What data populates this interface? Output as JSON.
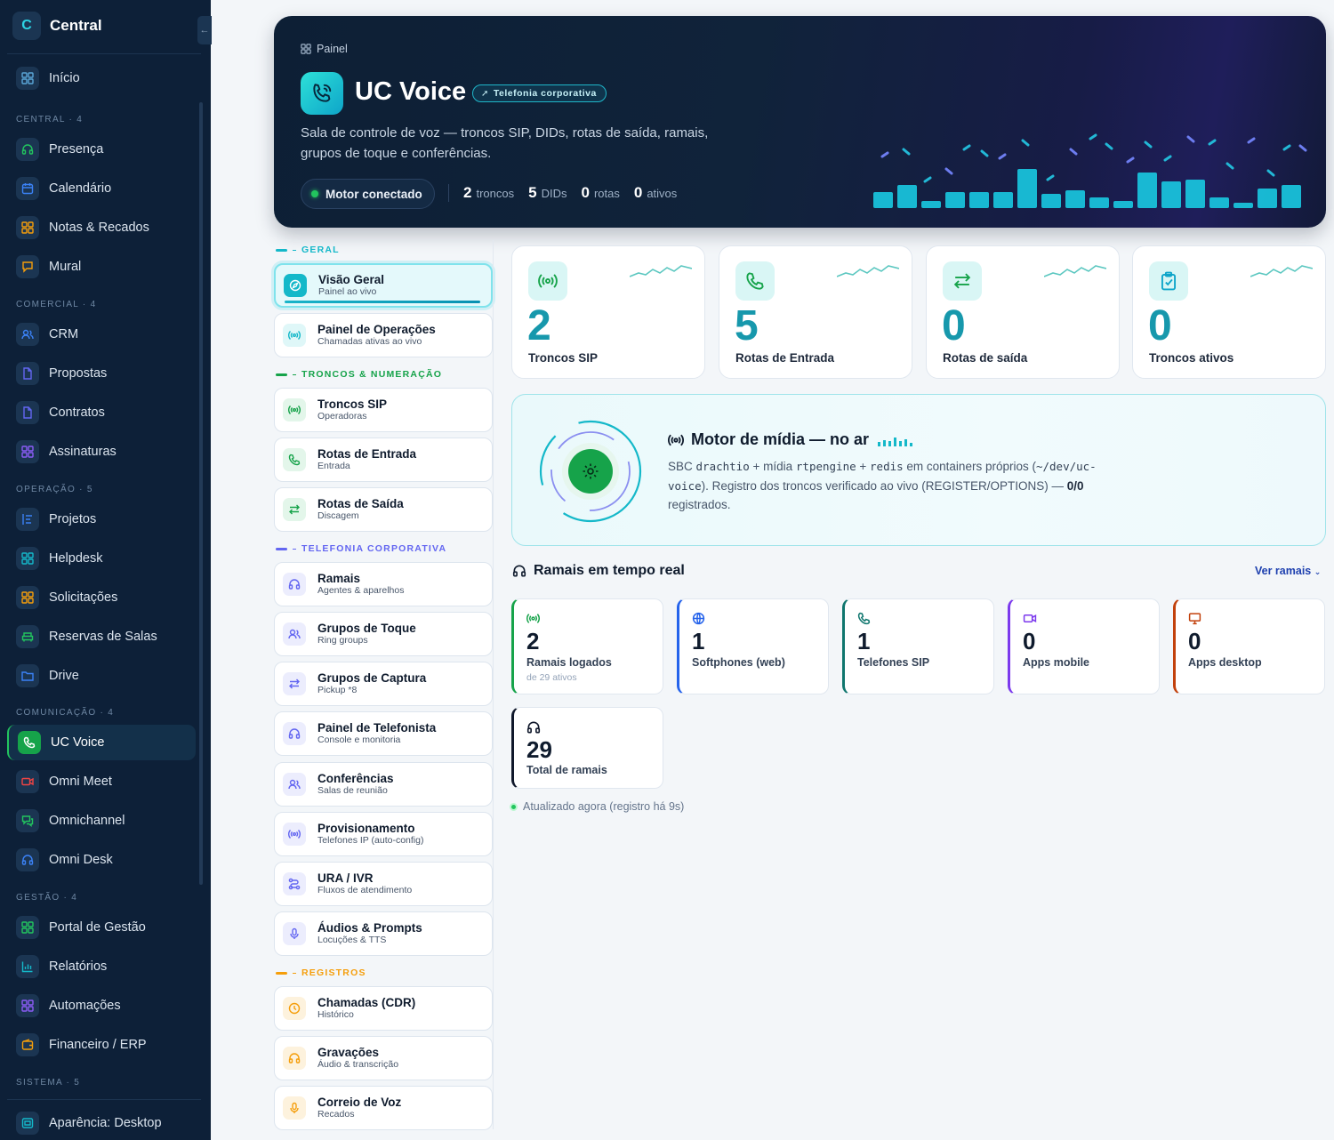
{
  "sidebar": {
    "brand": "Central",
    "items": [
      {
        "label": "Início",
        "icon": "grid-icon"
      },
      {
        "label": "Presença",
        "icon": "headset-icon"
      },
      {
        "label": "Calendário",
        "icon": "calendar-icon"
      },
      {
        "label": "Notas & Recados",
        "icon": "grid-icon"
      },
      {
        "label": "Mural",
        "icon": "message-icon"
      },
      {
        "label": "CRM",
        "icon": "users-icon"
      },
      {
        "label": "Propostas",
        "icon": "file-icon"
      },
      {
        "label": "Contratos",
        "icon": "file-icon"
      },
      {
        "label": "Assinaturas",
        "icon": "grid-icon"
      },
      {
        "label": "Projetos",
        "icon": "list-icon"
      },
      {
        "label": "Helpdesk",
        "icon": "grid-icon"
      },
      {
        "label": "Solicitações",
        "icon": "grid-icon"
      },
      {
        "label": "Reservas de Salas",
        "icon": "sofa-icon"
      },
      {
        "label": "Drive",
        "icon": "folder-icon"
      },
      {
        "label": "UC Voice",
        "icon": "phone-icon"
      },
      {
        "label": "Omni Meet",
        "icon": "video-icon"
      },
      {
        "label": "Omnichannel",
        "icon": "chat-icon"
      },
      {
        "label": "Omni Desk",
        "icon": "headset-icon"
      },
      {
        "label": "Portal de Gestão",
        "icon": "grid-icon"
      },
      {
        "label": "Relatórios",
        "icon": "chart-icon"
      },
      {
        "label": "Automações",
        "icon": "grid-icon"
      },
      {
        "label": "Financeiro / ERP",
        "icon": "wallet-icon"
      },
      {
        "label": "Aparência: Desktop",
        "icon": "monitor-icon"
      }
    ],
    "groups": [
      {
        "label": "CENTRAL · 4"
      },
      {
        "label": "COMERCIAL · 4"
      },
      {
        "label": "OPERAÇÃO · 5"
      },
      {
        "label": "COMUNICAÇÃO · 4"
      },
      {
        "label": "GESTÃO · 4"
      },
      {
        "label": "SISTEMA · 5"
      }
    ]
  },
  "hero": {
    "breadcrumb": "Painel",
    "title": "UC Voice",
    "tag": "Telefonia corporativa",
    "description": "Sala de controle de voz — troncos SIP, DIDs, rotas de saída, ramais, grupos de toque e conferências.",
    "status": "Motor conectado",
    "stats": [
      {
        "value": "2",
        "label": "troncos"
      },
      {
        "value": "5",
        "label": "DIDs"
      },
      {
        "value": "0",
        "label": "rotas"
      },
      {
        "value": "0",
        "label": "ativos"
      }
    ]
  },
  "subnav": {
    "groups": [
      {
        "label": "GERAL",
        "color": "#14b8c9"
      },
      {
        "label": "TRONCOS & NUMERAÇÃO",
        "color": "#16a34a"
      },
      {
        "label": "TELEFONIA CORPORATIVA",
        "color": "#6366f1"
      },
      {
        "label": "REGISTROS",
        "color": "#f59e0b"
      }
    ],
    "items": [
      {
        "title": "Visão Geral",
        "subtitle": "Painel ao vivo"
      },
      {
        "title": "Painel de Operações",
        "subtitle": "Chamadas ativas ao vivo"
      },
      {
        "title": "Troncos SIP",
        "subtitle": "Operadoras"
      },
      {
        "title": "Rotas de Entrada",
        "subtitle": "Entrada"
      },
      {
        "title": "Rotas de Saída",
        "subtitle": "Discagem"
      },
      {
        "title": "Ramais",
        "subtitle": "Agentes & aparelhos"
      },
      {
        "title": "Grupos de Toque",
        "subtitle": "Ring groups"
      },
      {
        "title": "Grupos de Captura",
        "subtitle": "Pickup *8"
      },
      {
        "title": "Painel de Telefonista",
        "subtitle": "Console e monitoria"
      },
      {
        "title": "Conferências",
        "subtitle": "Salas de reunião"
      },
      {
        "title": "Provisionamento",
        "subtitle": "Telefones IP (auto-config)"
      },
      {
        "title": "URA / IVR",
        "subtitle": "Fluxos de atendimento"
      },
      {
        "title": "Áudios & Prompts",
        "subtitle": "Locuções & TTS"
      },
      {
        "title": "Chamadas (CDR)",
        "subtitle": "Histórico"
      },
      {
        "title": "Gravações",
        "subtitle": "Áudio & transcrição"
      },
      {
        "title": "Correio de Voz",
        "subtitle": "Recados"
      }
    ]
  },
  "kpis": [
    {
      "value": "2",
      "label": "Troncos SIP",
      "icon": "broadcast-icon"
    },
    {
      "value": "5",
      "label": "Rotas de Entrada",
      "icon": "phone-icon"
    },
    {
      "value": "0",
      "label": "Rotas de saída",
      "icon": "arrows-icon"
    },
    {
      "value": "0",
      "label": "Troncos ativos",
      "icon": "clipboard-icon"
    }
  ],
  "motor": {
    "title": "Motor de mídia — no ar",
    "desc_1": "SBC ",
    "code_1": "drachtio",
    "desc_2": " + mídia ",
    "code_2": "rtpengine",
    "desc_3": " + ",
    "code_3": "redis",
    "desc_4": " em containers próprios (",
    "code_4": "~/dev/uc-voice",
    "desc_5": "). Registro dos troncos verificado ao vivo (REGISTER/OPTIONS) — ",
    "strong": "0/0",
    "desc_6": " registrados."
  },
  "realtime": {
    "title": "Ramais em tempo real",
    "link": "Ver ramais",
    "cards": [
      {
        "value": "2",
        "label": "Ramais logados",
        "sub": "de 29 ativos",
        "icon": "broadcast-icon",
        "color": "#16a34a"
      },
      {
        "value": "1",
        "label": "Softphones (web)",
        "icon": "globe-icon",
        "color": "#2563eb"
      },
      {
        "value": "1",
        "label": "Telefones SIP",
        "icon": "phone-icon",
        "color": "#0f766e"
      },
      {
        "value": "0",
        "label": "Apps mobile",
        "icon": "video-icon",
        "color": "#7c3aed"
      },
      {
        "value": "0",
        "label": "Apps desktop",
        "icon": "monitor-icon",
        "color": "#c2410c"
      },
      {
        "value": "29",
        "label": "Total de ramais",
        "icon": "headset-icon",
        "color": "#0f172a"
      }
    ],
    "updated": "Atualizado agora (registro há 9s)"
  },
  "colors": {
    "accent": "#14b8c9",
    "sidebar_bg": "#0d2038",
    "success": "#22c55e"
  }
}
